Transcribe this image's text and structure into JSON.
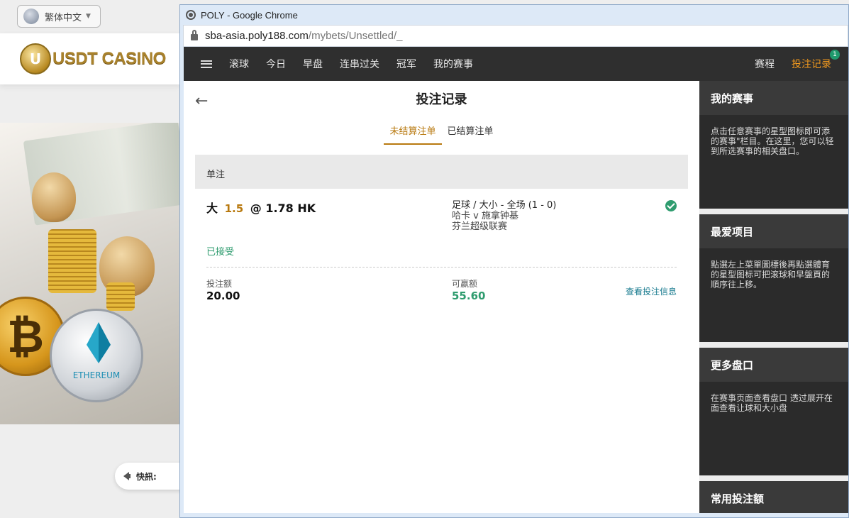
{
  "background": {
    "language": "繁体中文",
    "logo_text": "USDT CASINO",
    "logo_mark": "U",
    "eth_label": "ETHEREUM",
    "btc_symbol": "₿",
    "news_label": "快訊:"
  },
  "browser": {
    "title": "POLY - Google Chrome",
    "url_host": "sba-asia.poly188.com",
    "url_path": "/mybets/Unsettled/_"
  },
  "nav": {
    "items": [
      "滚球",
      "今日",
      "早盘",
      "连串过关",
      "冠军",
      "我的赛事"
    ],
    "right_items": [
      "赛程"
    ],
    "active_item": "投注记录",
    "badge": "1"
  },
  "page": {
    "title": "投注记录",
    "tabs": [
      "未结算注单",
      "已结算注单"
    ],
    "active_tab_index": 0,
    "section": "单注"
  },
  "bet": {
    "selection": "大",
    "handicap": "1.5",
    "odds": "@  1.78 HK",
    "market": "足球 / 大小 - 全场 (1 - 0)",
    "match": "哈卡 v 施拿钟基",
    "league": "芬兰超级联赛",
    "status": "已接受",
    "stake_label": "投注额",
    "stake": "20.00",
    "win_label": "可赢额",
    "win": "55.60",
    "details_link": "查看投注信息"
  },
  "sidebar": [
    {
      "title": "我的赛事",
      "text1": "点击任意赛事的星型图标即可添",
      "text2": "的赛事\"栏目。在这里，您可以轻",
      "text3": "到所选赛事的相关盘口。"
    },
    {
      "title": "最爱项目",
      "text1": "點選左上菜單圖標後再點選體育",
      "text2": "的星型图标可把滚球和早盤頁的",
      "text3": "順序往上移。"
    },
    {
      "title": "更多盘口",
      "text1": "在赛事页面查看盘口 透过展开在",
      "text2": "面查看让球和大小盘",
      "text3": ""
    },
    {
      "title": "常用投注额",
      "text1": "",
      "text2": "",
      "text3": ""
    }
  ],
  "colors": {
    "accent_orange": "#f39a1e",
    "tab_gold": "#b8790f",
    "success_green": "#2f9c6f",
    "nav_bg": "#2f2f2f"
  }
}
